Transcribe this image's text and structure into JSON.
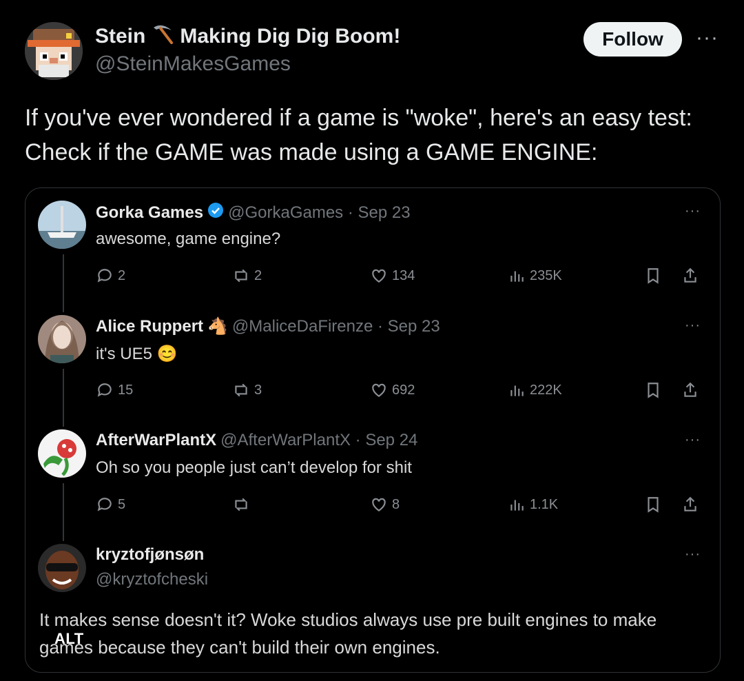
{
  "post": {
    "display_name": "Stein",
    "name_emoji": "⛏",
    "name_suffix": "Making Dig Dig Boom!",
    "handle": "@SteinMakesGames",
    "follow_label": "Follow",
    "more_label": "···",
    "text": "If you've ever wondered if a game is \"woke\", here's an easy test: Check if the GAME was made using a GAME ENGINE:"
  },
  "image": {
    "alt_label": "ALT",
    "replies": [
      {
        "name": "Gorka Games",
        "verified": true,
        "meta": "@GorkaGames · Sep 23",
        "text": "awesome, game engine?",
        "more": "···",
        "replies": "2",
        "reposts": "2",
        "likes": "134",
        "views": "235K"
      },
      {
        "name": "Alice Ruppert",
        "name_emoji": "🐴",
        "meta": "@MaliceDaFirenze · Sep 23",
        "text": "it's UE5",
        "text_emoji": "😊",
        "more": "···",
        "replies": "15",
        "reposts": "3",
        "likes": "692",
        "views": "222K"
      },
      {
        "name": "AfterWarPlantX",
        "meta": "@AfterWarPlantX · Sep 24",
        "text": "Oh so you people just can’t develop for shit",
        "more": "···",
        "replies": "5",
        "reposts": "",
        "likes": "8",
        "views": "1.1K"
      }
    ],
    "final": {
      "name": "kryztofjønsøn",
      "handle": "@kryztofcheski",
      "more": "···",
      "text": "It makes sense doesn't it? Woke studios always use pre built engines to make games because they can't build their own engines."
    }
  },
  "colors": {
    "background": "#000000",
    "text": "#e7e9ea",
    "muted": "#71767b",
    "verified": "#1d9bf0",
    "follow_bg": "#eff3f4"
  }
}
